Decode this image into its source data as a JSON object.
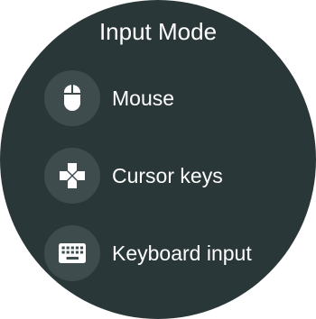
{
  "header": {
    "title": "Input Mode"
  },
  "menu": {
    "items": [
      {
        "label": "Mouse",
        "icon": "mouse-icon"
      },
      {
        "label": "Cursor keys",
        "icon": "dpad-icon"
      },
      {
        "label": "Keyboard input",
        "icon": "keyboard-icon"
      }
    ]
  },
  "colors": {
    "background": "#2a3739",
    "icon_circle": "#3f4c4e",
    "text": "#ffffff"
  }
}
